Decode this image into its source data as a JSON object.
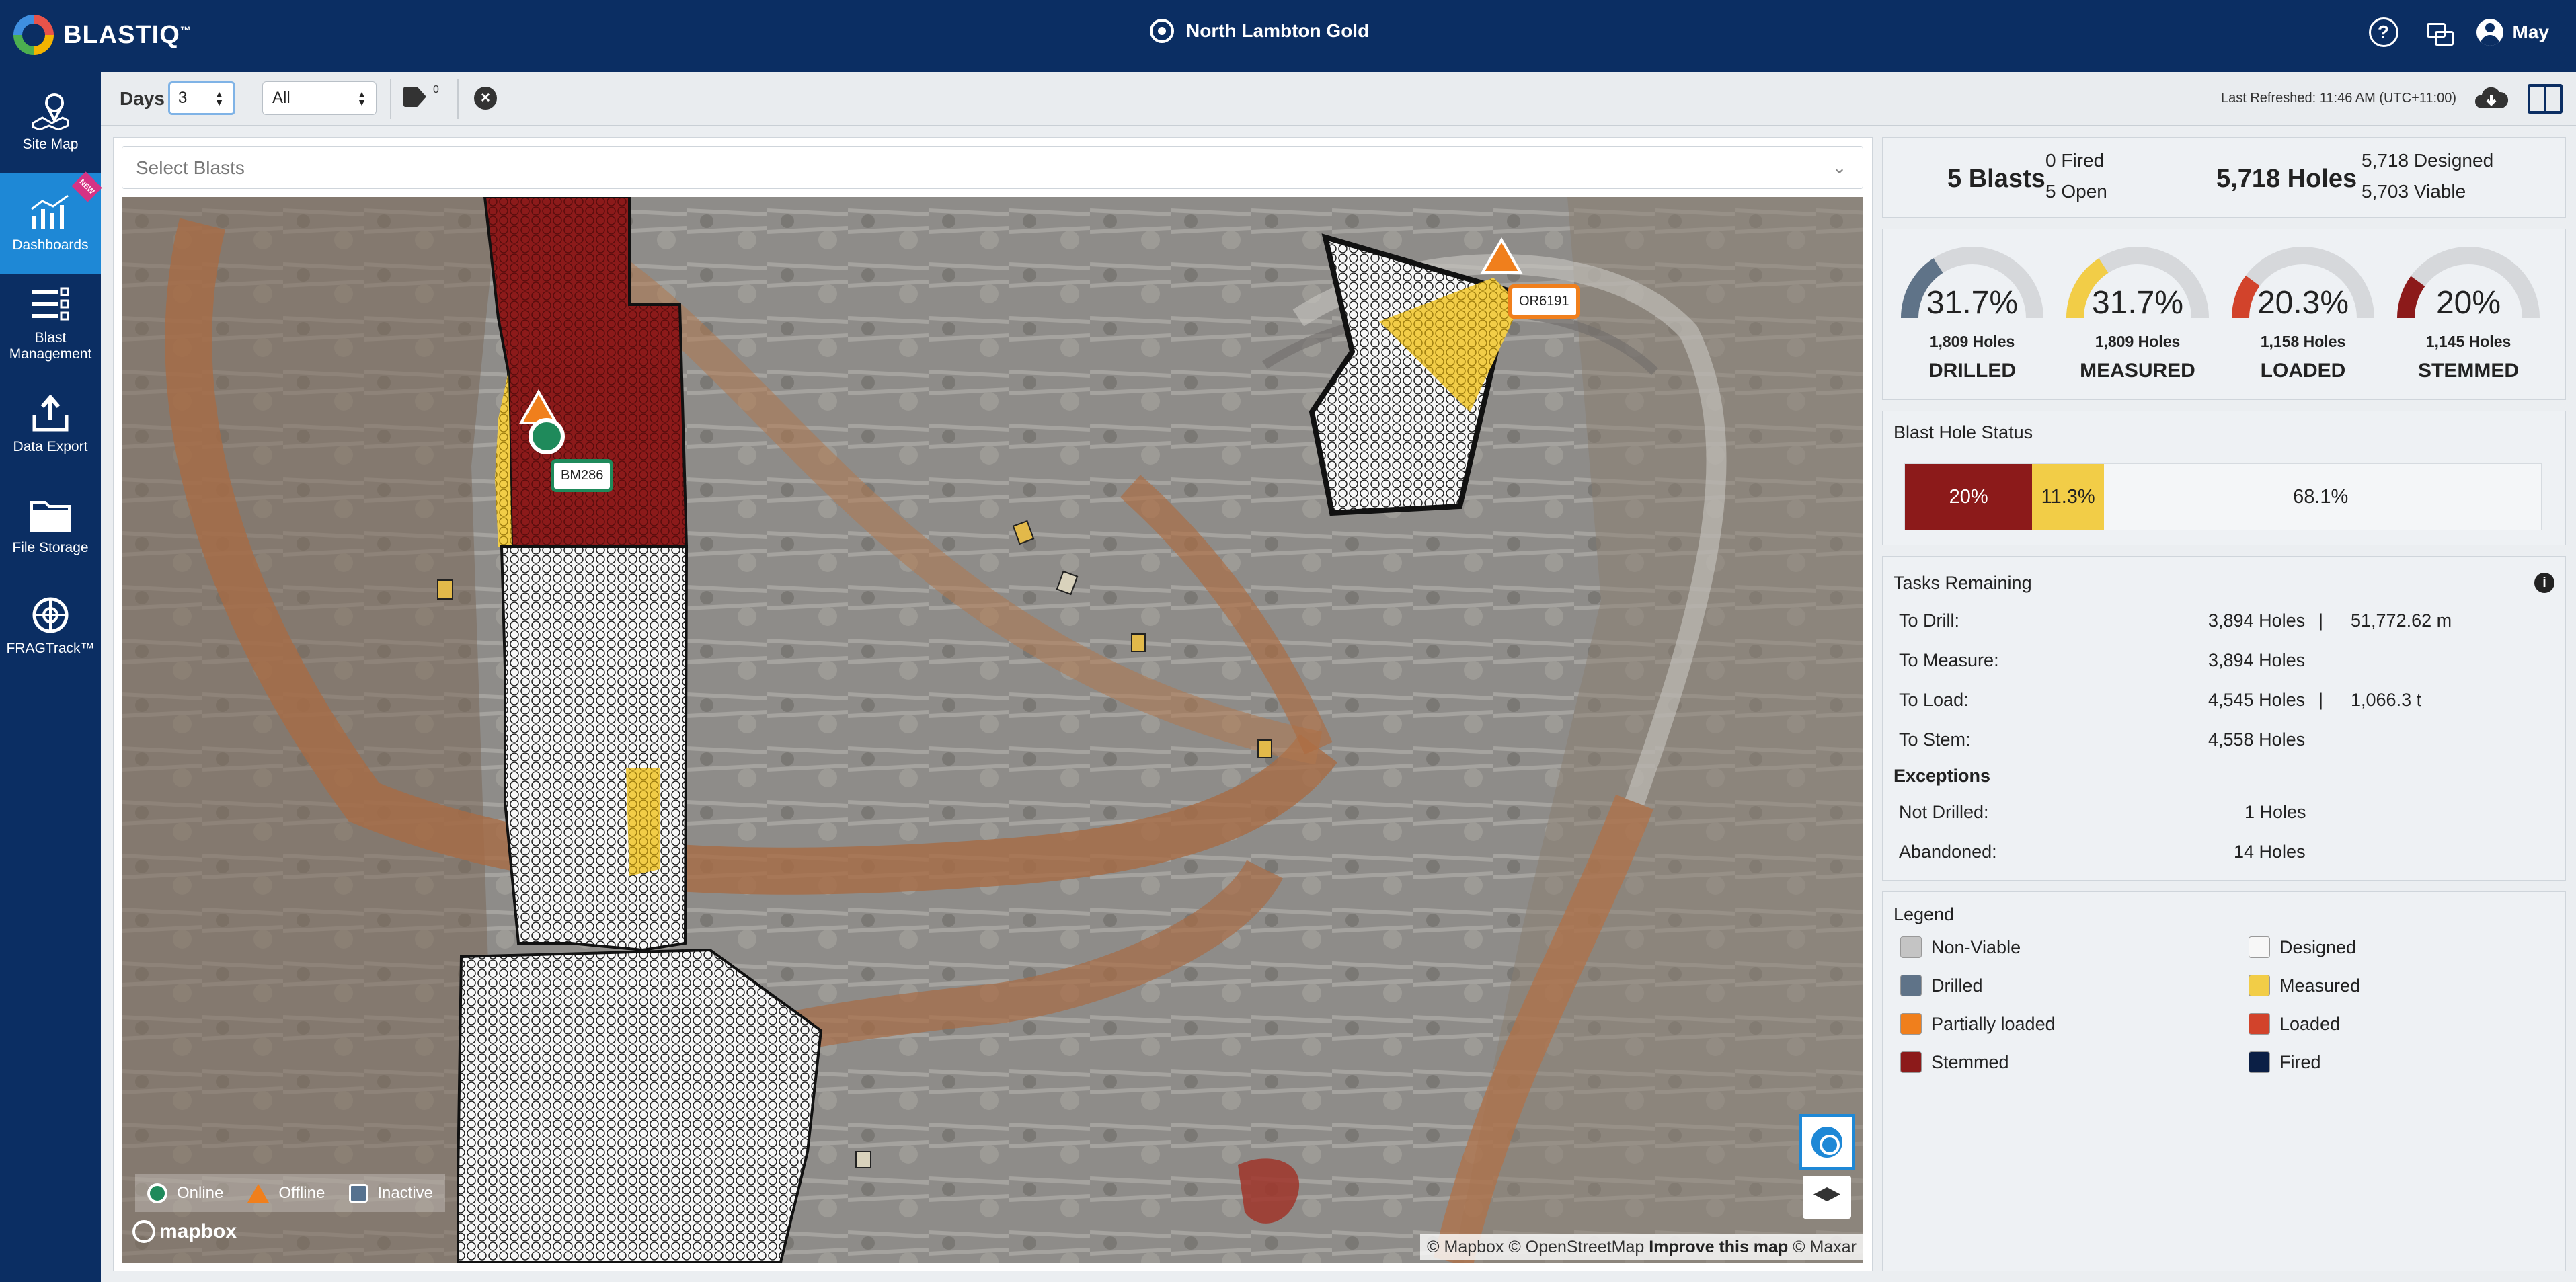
{
  "app": {
    "title": "BLASTIQ",
    "tm": "™",
    "site": "North Lambton Gold",
    "user": "May",
    "help": "?"
  },
  "sidebar": {
    "items": [
      {
        "label": "Site Map",
        "icon": "site-map-icon"
      },
      {
        "label": "Dashboards",
        "icon": "dashboards-icon",
        "badge": "NEW",
        "active": true
      },
      {
        "label": "Blast Management",
        "icon": "blast-management-icon"
      },
      {
        "label": "Data Export",
        "icon": "data-export-icon"
      },
      {
        "label": "File Storage",
        "icon": "file-storage-icon"
      },
      {
        "label": "FRAGTrack™",
        "icon": "fragtrack-icon"
      }
    ]
  },
  "toolbar": {
    "days_label": "Days",
    "days_value": "3",
    "filter_value": "All",
    "tag_count": "0",
    "last_refreshed": "Last Refreshed: 11:46 AM (UTC+11:00)"
  },
  "map": {
    "select_placeholder": "Select Blasts",
    "labels": {
      "bm": "BM286",
      "or": "OR6191"
    },
    "legend": {
      "online": "Online",
      "offline": "Offline",
      "inactive": "Inactive"
    },
    "mapbox": "mapbox",
    "attribution_a": "© Mapbox © OpenStreetMap ",
    "attribution_b": "Improve this map",
    "attribution_c": " © Maxar"
  },
  "summary": {
    "blasts": "5 Blasts",
    "fired": "0 Fired",
    "open": "5 Open",
    "holes": "5,718 Holes",
    "designed": "5,718 Designed",
    "viable": "5,703 Viable"
  },
  "gauges": [
    {
      "pct": "31.7%",
      "value": 0.317,
      "holes": "1,809 Holes",
      "name": "DRILLED",
      "color": "#5f7388"
    },
    {
      "pct": "31.7%",
      "value": 0.317,
      "holes": "1,809 Holes",
      "name": "MEASURED",
      "color": "#f2cd47"
    },
    {
      "pct": "20.3%",
      "value": 0.203,
      "holes": "1,158 Holes",
      "name": "LOADED",
      "color": "#d2432b"
    },
    {
      "pct": "20%",
      "value": 0.2,
      "holes": "1,145 Holes",
      "name": "STEMMED",
      "color": "#8c1a1a"
    }
  ],
  "blast_hole_status": {
    "title": "Blast Hole Status",
    "segments": [
      {
        "label": "20%",
        "value": 20,
        "color": "#8c1a1a",
        "text_color": "#ffffff"
      },
      {
        "label": "11.3%",
        "value": 11.3,
        "color": "#f2cd47",
        "text_color": "#222222"
      },
      {
        "label": "68.1%",
        "value": 68.1,
        "color": "#f4f6f8",
        "text_color": "#222222"
      }
    ]
  },
  "tasks": {
    "title": "Tasks Remaining",
    "to_drill_label": "To Drill:",
    "to_drill_holes": "3,894 Holes",
    "to_drill_sep": "|",
    "to_drill_m": "51,772.62 m",
    "to_measure_label": "To Measure:",
    "to_measure_holes": "3,894 Holes",
    "to_load_label": "To Load:",
    "to_load_holes": "4,545 Holes",
    "to_load_sep": "|",
    "to_load_t": "1,066.3 t",
    "to_stem_label": "To Stem:",
    "to_stem_holes": "4,558 Holes",
    "exceptions_title": "Exceptions",
    "not_drilled_label": "Not Drilled:",
    "not_drilled_value": "1 Holes",
    "abandoned_label": "Abandoned:",
    "abandoned_value": "14 Holes"
  },
  "legend": {
    "title": "Legend",
    "items": [
      {
        "label": "Non-Viable",
        "color": "#c4c4c4"
      },
      {
        "label": "Designed",
        "color": "#f7f7f7"
      },
      {
        "label": "Drilled",
        "color": "#5f7388"
      },
      {
        "label": "Measured",
        "color": "#f2cd47"
      },
      {
        "label": "Partially loaded",
        "color": "#f07f1c"
      },
      {
        "label": "Loaded",
        "color": "#d2432b"
      },
      {
        "label": "Stemmed",
        "color": "#8c1a1a"
      },
      {
        "label": "Fired",
        "color": "#0b1f45"
      }
    ]
  }
}
